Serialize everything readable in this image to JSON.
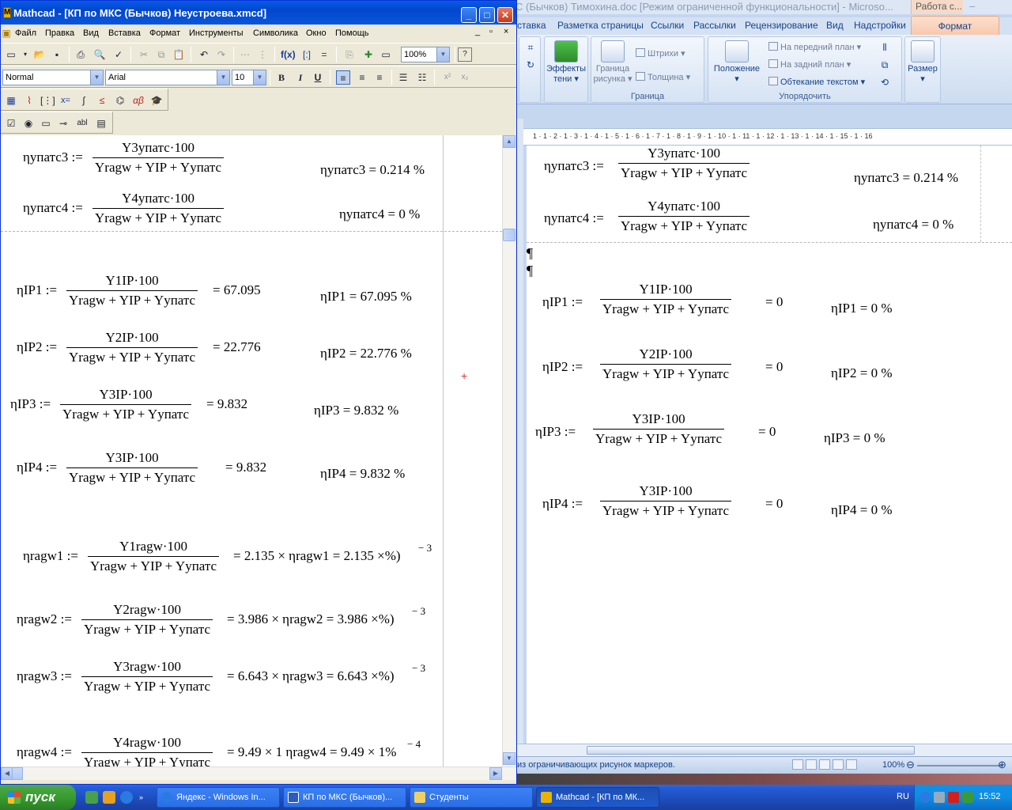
{
  "mathcad": {
    "title": "Mathcad - [КП по МКС (Бычков) Неустроева.xmcd]",
    "menu": [
      "Файл",
      "Правка",
      "Вид",
      "Вставка",
      "Формат",
      "Инструменты",
      "Символика",
      "Окно",
      "Помощь"
    ],
    "zoom": "100%",
    "style": "Normal",
    "font": "Arial",
    "font_size": "10",
    "formulas": {
      "f_u3": {
        "lhs": "ηупатс3 :=",
        "num": "Y3упатс·100",
        "den": "Yragw + YIP + Yупатс",
        "result": "ηупатс3 = 0.214 %"
      },
      "f_u4": {
        "lhs": "ηупатс4 :=",
        "num": "Y4упатс·100",
        "den": "Yragw + YIP + Yупатс",
        "result": "ηупатс4 = 0 %"
      },
      "f_ip1": {
        "lhs": "ηIP1 :=",
        "num": "Y1IP·100",
        "den": "Yragw + YIP + Yупатс",
        "eq": "= 67.095",
        "result": "ηIP1 = 67.095 %"
      },
      "f_ip2": {
        "lhs": "ηIP2 :=",
        "num": "Y2IP·100",
        "den": "Yragw + YIP + Yупатс",
        "eq": "= 22.776",
        "result": "ηIP2 = 22.776 %"
      },
      "f_ip3": {
        "lhs": "ηIP3 :=",
        "num": "Y3IP·100",
        "den": "Yragw + YIP + Yупатс",
        "eq": "= 9.832",
        "result": "ηIP3 = 9.832 %"
      },
      "f_ip4": {
        "lhs": "ηIP4 :=",
        "num": "Y3IP·100",
        "den": "Yragw + YIP + Yупатс",
        "eq": "= 9.832",
        "result": "ηIP4 = 9.832 %"
      },
      "f_r1": {
        "lhs": "ηragw1 :=",
        "num": "Y1ragw·100",
        "den": "Yragw + YIP + Yупатс",
        "eq": "= 2.135 × ηragw1 = 2.135 ×%)",
        "exp": "− 3"
      },
      "f_r2": {
        "lhs": "ηragw2 :=",
        "num": "Y2ragw·100",
        "den": "Yragw + YIP + Yупатс",
        "eq": "= 3.986 × ηragw2 = 3.986 ×%)",
        "exp": "− 3"
      },
      "f_r3": {
        "lhs": "ηragw3 :=",
        "num": "Y3ragw·100",
        "den": "Yragw + YIP + Yупатс",
        "eq": "= 6.643 × ηragw3 = 6.643 ×%)",
        "exp": "− 3"
      },
      "f_r4": {
        "lhs": "ηragw4 :=",
        "num": "Y4ragw·100",
        "den": "Yragw + YIP + Yупатс",
        "eq": "= 9.49 × 1 ηragw4 = 9.49 × 1%",
        "exp": "− 4"
      }
    }
  },
  "word": {
    "title": "С (Бычков) Тимохина.doc [Режим ограниченной функциональности] - Microso...",
    "context_tab": "Работа с...",
    "tabs": [
      "ставка",
      "Разметка страницы",
      "Ссылки",
      "Рассылки",
      "Рецензирование",
      "Вид",
      "Надстройки"
    ],
    "active_tab": "Формат",
    "ribbon": {
      "effects_label": "Эффекты тени",
      "border_label": "Граница рисунка",
      "strokes": "Штрихи",
      "thickness": "Толщина",
      "border_group": "Граница",
      "position_label": "Положение",
      "front": "На передний план",
      "back": "На задний план",
      "wrap": "Обтекание текстом",
      "arrange_group": "Упорядочить",
      "size_label": "Размер"
    },
    "ruler": "1 · 1 · 2 · 1 · 3 · 1 · 4 · 1 · 5 · 1 · 6 · 1 · 7 · 1 · 8 · 1 · 9 · 1 · 10 · 1 · 11 · 1 · 12 · 1 · 13 · 1 · 14 · 1 · 15 · 1 · 16",
    "pilcrow": "¶",
    "formulas": {
      "w_u3": {
        "lhs": "ηупатс3 :=",
        "num": "Y3упатс·100",
        "den": "Yragw + YIP + Yупатс",
        "result": "ηупатс3 = 0.214 %"
      },
      "w_u4": {
        "lhs": "ηупатс4 :=",
        "num": "Y4упатс·100",
        "den": "Yragw + YIP + Yупатс",
        "result": "ηупатс4 = 0 %"
      },
      "w_ip1": {
        "lhs": "ηIP1 :=",
        "num": "Y1IP·100",
        "den": "Yragw + YIP + Yупатс",
        "eq": "= 0",
        "result": "ηIP1 = 0 %"
      },
      "w_ip2": {
        "lhs": "ηIP2 :=",
        "num": "Y2IP·100",
        "den": "Yragw + YIP + Yупатс",
        "eq": "= 0",
        "result": "ηIP2 = 0 %"
      },
      "w_ip3": {
        "lhs": "ηIP3 :=",
        "num": "Y3IP·100",
        "den": "Yragw + YIP + Yупатс",
        "eq": "= 0",
        "result": "ηIP3 = 0 %"
      },
      "w_ip4": {
        "lhs": "ηIP4 :=",
        "num": "Y3IP·100",
        "den": "Yragw + YIP + Yупатс",
        "eq": "= 0",
        "result": "ηIP4 = 0 %"
      }
    },
    "status_text": "из ограничивающих рисунок маркеров.",
    "zoom": "100%"
  },
  "taskbar": {
    "start": "пуск",
    "tasks": [
      "Яндекс - Windows In...",
      "КП по МКС (Бычков)...",
      "Студенты",
      "Mathcad - [КП по МК..."
    ],
    "lang": "RU",
    "clock": "15:52"
  }
}
